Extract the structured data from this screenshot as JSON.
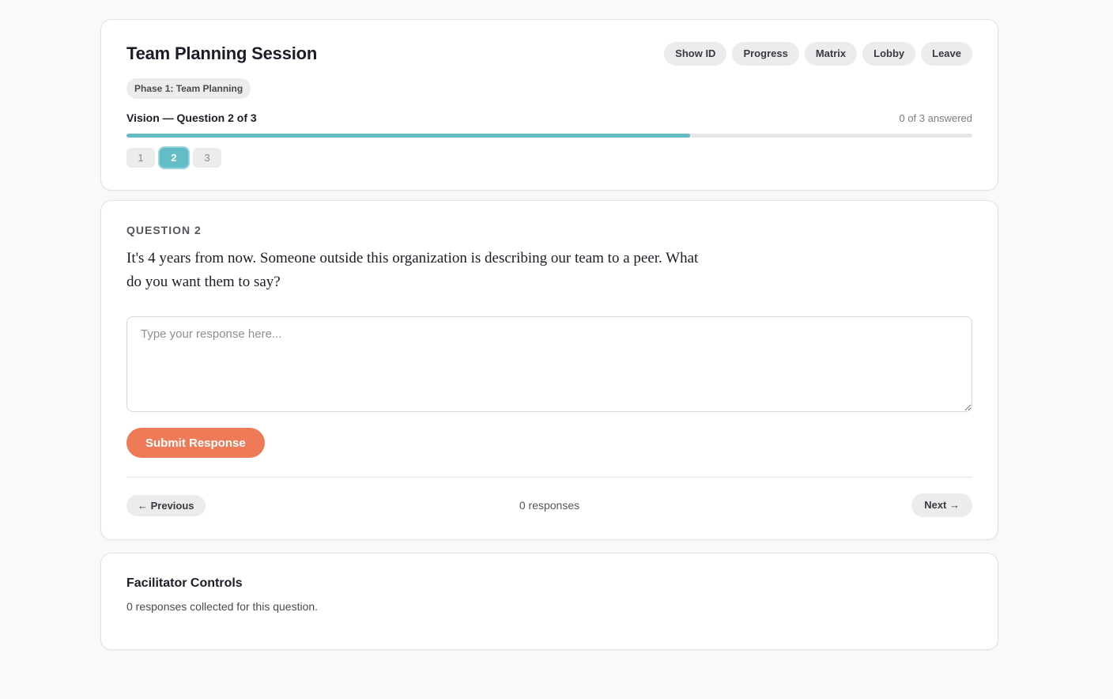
{
  "header": {
    "title": "Team Planning Session",
    "nav_buttons": [
      "Show ID",
      "Progress",
      "Matrix",
      "Lobby",
      "Leave"
    ],
    "phase_badge": "Phase 1: Team Planning",
    "progress_label": "Vision — Question 2 of 3",
    "answered_text": "0 of 3 answered",
    "progress_fraction": 0.6667,
    "question_steps": [
      "1",
      "2",
      "3"
    ],
    "active_step": "2"
  },
  "question": {
    "eyebrow": "QUESTION 2",
    "text": "It's 4 years from now. Someone outside this organization is describing our team to a peer. What do you want them to say?",
    "response_placeholder": "Type your response here...",
    "response_value": "",
    "submit_label": "Submit Response",
    "prev_label": "← Previous",
    "next_label": "Next →",
    "responses_text": "0 responses"
  },
  "facilitator": {
    "title": "Facilitator Controls",
    "note": "0 responses collected for this question."
  },
  "colors": {
    "accent_teal": "#63bcc6",
    "submit_orange": "#ee7a58",
    "page_background": "#f9f9f9"
  }
}
